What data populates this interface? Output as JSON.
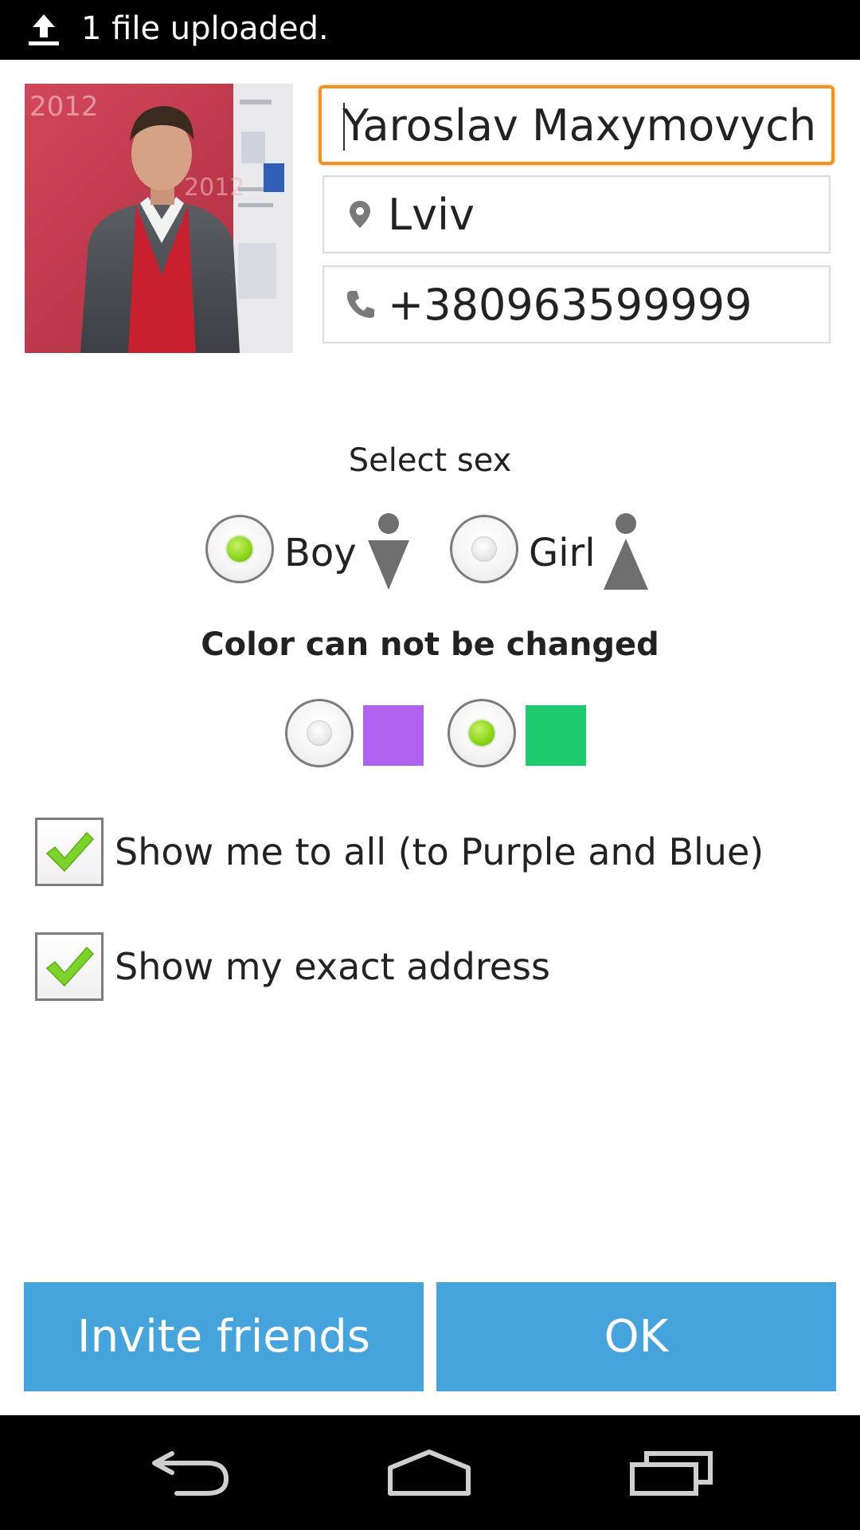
{
  "status_bar": {
    "notification_icon": "upload-icon",
    "notification_text": "1 file uploaded."
  },
  "profile": {
    "photo_icon": "profile-photo",
    "name_value": "Yaroslav Maxymovych",
    "city_icon": "location-pin-icon",
    "city_value": "Lviv",
    "phone_icon": "phone-icon",
    "phone_value": "+380963599999"
  },
  "sex": {
    "label": "Select sex",
    "options": [
      {
        "label": "Boy",
        "icon": "male-icon",
        "selected": true
      },
      {
        "label": "Girl",
        "icon": "female-icon",
        "selected": false
      }
    ]
  },
  "color": {
    "label": "Color can not be changed",
    "options": [
      {
        "color": "#b061ee",
        "selected": false
      },
      {
        "color": "#1ecb6e",
        "selected": true
      }
    ]
  },
  "options": {
    "show_all": {
      "label": "Show me to all (to Purple and Blue)",
      "checked": true
    },
    "exact_address": {
      "label": "Show my exact address",
      "checked": true
    }
  },
  "buttons": {
    "invite_label": "Invite friends",
    "ok_label": "OK",
    "color": "#45a4dc"
  },
  "focus_color": "#f29222",
  "nav_bar": {
    "icons": [
      "back-icon",
      "home-icon",
      "recent-apps-icon"
    ]
  }
}
